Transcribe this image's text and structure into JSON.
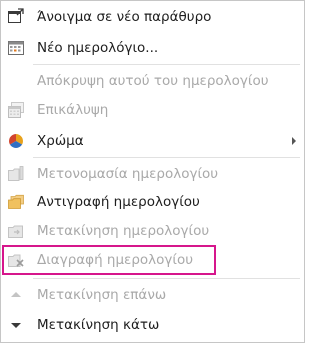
{
  "menu": {
    "items": [
      {
        "label": "Άνοιγμα σε νέο παράθυρο",
        "enabled": true,
        "icon": "new-window-icon"
      },
      {
        "label": "Νέο ημερολόγιο...",
        "enabled": true,
        "icon": "new-calendar-icon"
      },
      {
        "label": "Απόκρυψη αυτού του ημερολογίου",
        "enabled": false,
        "icon": ""
      },
      {
        "label": "Επικάλυψη",
        "enabled": false,
        "icon": "overlay-icon"
      },
      {
        "label": "Χρώμα",
        "enabled": true,
        "icon": "color-pie-icon",
        "has_submenu": true
      },
      {
        "label": "Μετονομασία ημερολογίου",
        "enabled": false,
        "icon": "rename-folder-icon"
      },
      {
        "label": "Αντιγραφή ημερολογίου",
        "enabled": true,
        "icon": "copy-folder-icon"
      },
      {
        "label": "Μετακίνηση ημερολογίου",
        "enabled": false,
        "icon": "move-folder-icon"
      },
      {
        "label": "Διαγραφή ημερολογίου",
        "enabled": false,
        "icon": "delete-calendar-icon",
        "highlighted": true
      },
      {
        "label": "Μετακίνηση επάνω",
        "enabled": false,
        "icon": "move-up-icon"
      },
      {
        "label": "Μετακίνηση κάτω",
        "enabled": true,
        "icon": "move-down-icon"
      }
    ]
  },
  "colors": {
    "highlight": "#d6168c",
    "disabled_text": "#a9a9a9",
    "enabled_text": "#1e1e1e"
  }
}
